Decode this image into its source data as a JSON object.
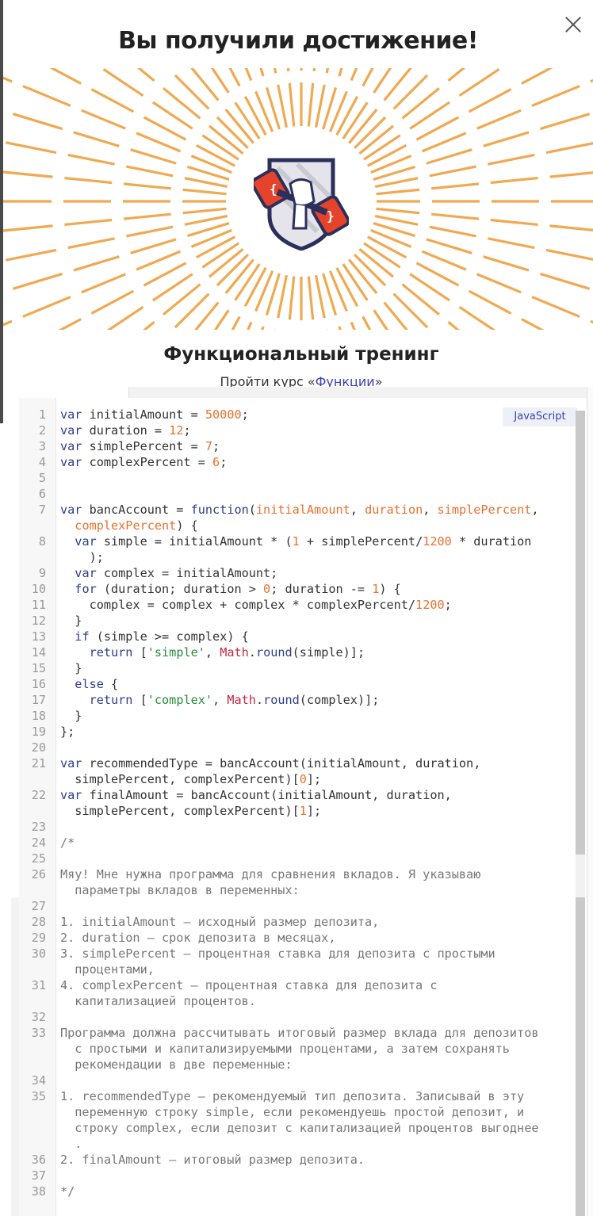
{
  "modal": {
    "title": "Вы получили достижение!",
    "achievement_name": "Функциональный тренинг",
    "description_prefix": "Пройти курс «",
    "course_link": "Функции",
    "description_suffix": "»",
    "close_icon": "close-icon",
    "badge_icon": "dumbbell-fist-icon"
  },
  "editor": {
    "language": "JavaScript",
    "colors": {
      "keyword": "#2c3d8c",
      "number": "#e9702e",
      "string": "#2a8a3e",
      "builtin": "#c0283f",
      "comment": "#777777"
    },
    "lines": [
      {
        "n": "1",
        "html": "<span class='kw'>var</span> initialAmount = <span class='num'>50000</span>;"
      },
      {
        "n": "2",
        "html": "<span class='kw'>var</span> duration = <span class='num'>12</span>;"
      },
      {
        "n": "3",
        "html": "<span class='kw'>var</span> simplePercent = <span class='num'>7</span>;"
      },
      {
        "n": "4",
        "html": "<span class='kw'>var</span> complexPercent = <span class='num'>6</span>;"
      },
      {
        "n": "5",
        "html": ""
      },
      {
        "n": "6",
        "html": ""
      },
      {
        "n": "7",
        "html": "<span class='kw'>var</span> bancAccount = <span class='kw'>function</span>(<span class='prm'>initialAmount</span>, <span class='prm'>duration</span>, <span class='prm'>simplePercent</span>,"
      },
      {
        "n": "",
        "html": "  <span class='prm'>complexPercent</span>) {"
      },
      {
        "n": "8",
        "html": "  <span class='kw'>var</span> simple = initialAmount * (<span class='num'>1</span> + simplePercent/<span class='num'>1200</span> * duration"
      },
      {
        "n": "",
        "html": "    );"
      },
      {
        "n": "9",
        "html": "  <span class='kw'>var</span> complex = initialAmount;"
      },
      {
        "n": "10",
        "html": "  <span class='kw'>for</span> (duration; duration > <span class='num'>0</span>; duration -= <span class='num'>1</span>) {"
      },
      {
        "n": "11",
        "html": "    complex = complex + complex * complexPercent/<span class='num'>1200</span>;"
      },
      {
        "n": "12",
        "html": "  }"
      },
      {
        "n": "13",
        "html": "  <span class='kw'>if</span> (simple >= complex) {"
      },
      {
        "n": "14",
        "html": "    <span class='kw'>return</span> [<span class='str'>'simple'</span>, <span class='obj'>Math</span>.<span class='kw'>round</span>(simple)];"
      },
      {
        "n": "15",
        "html": "  }"
      },
      {
        "n": "16",
        "html": "  <span class='kw'>else</span> {"
      },
      {
        "n": "17",
        "html": "    <span class='kw'>return</span> [<span class='str'>'complex'</span>, <span class='obj'>Math</span>.<span class='kw'>round</span>(complex)];"
      },
      {
        "n": "18",
        "html": "  }"
      },
      {
        "n": "19",
        "html": "};"
      },
      {
        "n": "20",
        "html": ""
      },
      {
        "n": "21",
        "html": "<span class='kw'>var</span> recommendedType = bancAccount(initialAmount, duration,"
      },
      {
        "n": "",
        "html": "  simplePercent, complexPercent)[<span class='num'>0</span>];"
      },
      {
        "n": "22",
        "html": "<span class='kw'>var</span> finalAmount = bancAccount(initialAmount, duration,"
      },
      {
        "n": "",
        "html": "  simplePercent, complexPercent)[<span class='num'>1</span>];"
      },
      {
        "n": "23",
        "html": ""
      },
      {
        "n": "24",
        "html": "<span class='cm'>/*</span>"
      },
      {
        "n": "25",
        "html": ""
      },
      {
        "n": "26",
        "html": "<span class='cm'>Мяу! Мне нужна программа для сравнения вкладов. Я указываю</span>"
      },
      {
        "n": "",
        "html": "<span class='cm'>  параметры вкладов в переменных:</span>"
      },
      {
        "n": "27",
        "html": ""
      },
      {
        "n": "28",
        "html": "<span class='cm'>1. initialAmount — исходный размер депозита,</span>"
      },
      {
        "n": "29",
        "html": "<span class='cm'>2. duration — срок депозита в месяцах,</span>"
      },
      {
        "n": "30",
        "html": "<span class='cm'>3. simplePercent — процентная ставка для депозита с простыми</span>"
      },
      {
        "n": "",
        "html": "<span class='cm'>  процентами,</span>"
      },
      {
        "n": "31",
        "html": "<span class='cm'>4. complexPercent — процентная ставка для депозита с</span>"
      },
      {
        "n": "",
        "html": "<span class='cm'>  капитализацией процентов.</span>"
      },
      {
        "n": "32",
        "html": ""
      },
      {
        "n": "33",
        "html": "<span class='cm'>Программа должна рассчитывать итоговый размер вклада для депозитов</span>"
      },
      {
        "n": "",
        "html": "<span class='cm'>  с простыми и капитализируемыми процентами, а затем сохранять</span>"
      },
      {
        "n": "",
        "html": "<span class='cm'>  рекомендации в две переменные:</span>"
      },
      {
        "n": "34",
        "html": ""
      },
      {
        "n": "35",
        "html": "<span class='cm'>1. recommendedType — рекомендуемый тип депозита. Записывай в эту</span>"
      },
      {
        "n": "",
        "html": "<span class='cm'>  переменную строку simple, если рекомендуешь простой депозит, и</span>"
      },
      {
        "n": "",
        "html": "<span class='cm'>  строку complex, если депозит с капитализацией процентов выгоднее</span>"
      },
      {
        "n": "",
        "html": "<span class='cm'>  .</span>"
      },
      {
        "n": "36",
        "html": "<span class='cm'>2. finalAmount — итоговый размер депозита.</span>"
      },
      {
        "n": "37",
        "html": ""
      },
      {
        "n": "38",
        "html": "<span class='cm'>*/</span>"
      }
    ]
  }
}
